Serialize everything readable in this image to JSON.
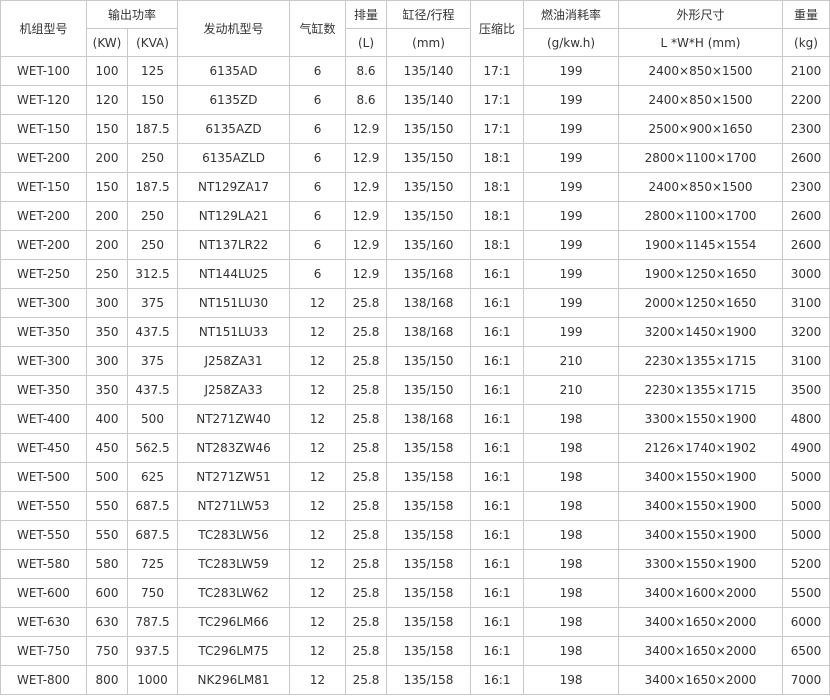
{
  "header": {
    "model": "机组型号",
    "output_power": "输出功率",
    "kw": "(KW)",
    "kva": "(KVA)",
    "engine_model": "发动机型号",
    "cylinders": "气缸数",
    "displacement": "排量",
    "displacement_unit": "(L)",
    "bore_stroke": "缸径/行程",
    "bore_stroke_unit": "(mm)",
    "compression_ratio": "压缩比",
    "fuel_consumption": "燃油消耗率",
    "fuel_consumption_unit": "(g/kw.h)",
    "dimensions": "外形尺寸",
    "dimensions_unit": "L *W*H (mm)",
    "weight": "重量",
    "weight_unit": "(kg)"
  },
  "rows": [
    [
      "WET-100",
      "100",
      "125",
      "6135AD",
      "6",
      "8.6",
      "135/140",
      "17:1",
      "199",
      "2400×850×1500",
      "2100"
    ],
    [
      "WET-120",
      "120",
      "150",
      "6135ZD",
      "6",
      "8.6",
      "135/140",
      "17:1",
      "199",
      "2400×850×1500",
      "2200"
    ],
    [
      "WET-150",
      "150",
      "187.5",
      "6135AZD",
      "6",
      "12.9",
      "135/150",
      "17:1",
      "199",
      "2500×900×1650",
      "2300"
    ],
    [
      "WET-200",
      "200",
      "250",
      "6135AZLD",
      "6",
      "12.9",
      "135/150",
      "18:1",
      "199",
      "2800×1100×1700",
      "2600"
    ],
    [
      "WET-150",
      "150",
      "187.5",
      "NT129ZA17",
      "6",
      "12.9",
      "135/150",
      "18:1",
      "199",
      "2400×850×1500",
      "2300"
    ],
    [
      "WET-200",
      "200",
      "250",
      "NT129LA21",
      "6",
      "12.9",
      "135/150",
      "18:1",
      "199",
      "2800×1100×1700",
      "2600"
    ],
    [
      "WET-200",
      "200",
      "250",
      "NT137LR22",
      "6",
      "12.9",
      "135/160",
      "18:1",
      "199",
      "1900×1145×1554",
      "2600"
    ],
    [
      "WET-250",
      "250",
      "312.5",
      "NT144LU25",
      "6",
      "12.9",
      "135/168",
      "16:1",
      "199",
      "1900×1250×1650",
      "3000"
    ],
    [
      "WET-300",
      "300",
      "375",
      "NT151LU30",
      "12",
      "25.8",
      "138/168",
      "16:1",
      "199",
      "2000×1250×1650",
      "3100"
    ],
    [
      "WET-350",
      "350",
      "437.5",
      "NT151LU33",
      "12",
      "25.8",
      "138/168",
      "16:1",
      "199",
      "3200×1450×1900",
      "3200"
    ],
    [
      "WET-300",
      "300",
      "375",
      "J258ZA31",
      "12",
      "25.8",
      "135/150",
      "16:1",
      "210",
      "2230×1355×1715",
      "3100"
    ],
    [
      "WET-350",
      "350",
      "437.5",
      "J258ZA33",
      "12",
      "25.8",
      "135/150",
      "16:1",
      "210",
      "2230×1355×1715",
      "3500"
    ],
    [
      "WET-400",
      "400",
      "500",
      "NT271ZW40",
      "12",
      "25.8",
      "138/168",
      "16:1",
      "198",
      "3300×1550×1900",
      "4800"
    ],
    [
      "WET-450",
      "450",
      "562.5",
      "NT283ZW46",
      "12",
      "25.8",
      "135/158",
      "16:1",
      "198",
      "2126×1740×1902",
      "4900"
    ],
    [
      "WET-500",
      "500",
      "625",
      "NT271ZW51",
      "12",
      "25.8",
      "135/158",
      "16:1",
      "198",
      "3400×1550×1900",
      "5000"
    ],
    [
      "WET-550",
      "550",
      "687.5",
      "NT271LW53",
      "12",
      "25.8",
      "135/158",
      "16:1",
      "198",
      "3400×1550×1900",
      "5000"
    ],
    [
      "WET-550",
      "550",
      "687.5",
      "TC283LW56",
      "12",
      "25.8",
      "135/158",
      "16:1",
      "198",
      "3400×1550×1900",
      "5000"
    ],
    [
      "WET-580",
      "580",
      "725",
      "TC283LW59",
      "12",
      "25.8",
      "135/158",
      "16:1",
      "198",
      "3300×1550×1900",
      "5200"
    ],
    [
      "WET-600",
      "600",
      "750",
      "TC283LW62",
      "12",
      "25.8",
      "135/158",
      "16:1",
      "198",
      "3400×1600×2000",
      "5500"
    ],
    [
      "WET-630",
      "630",
      "787.5",
      "TC296LM66",
      "12",
      "25.8",
      "135/158",
      "16:1",
      "198",
      "3400×1650×2000",
      "6000"
    ],
    [
      "WET-750",
      "750",
      "937.5",
      "TC296LM75",
      "12",
      "25.8",
      "135/158",
      "16:1",
      "198",
      "3400×1650×2000",
      "6500"
    ],
    [
      "WET-800",
      "800",
      "1000",
      "NK296LM81",
      "12",
      "25.8",
      "135/158",
      "16:1",
      "198",
      "3400×1650×2000",
      "7000"
    ]
  ]
}
